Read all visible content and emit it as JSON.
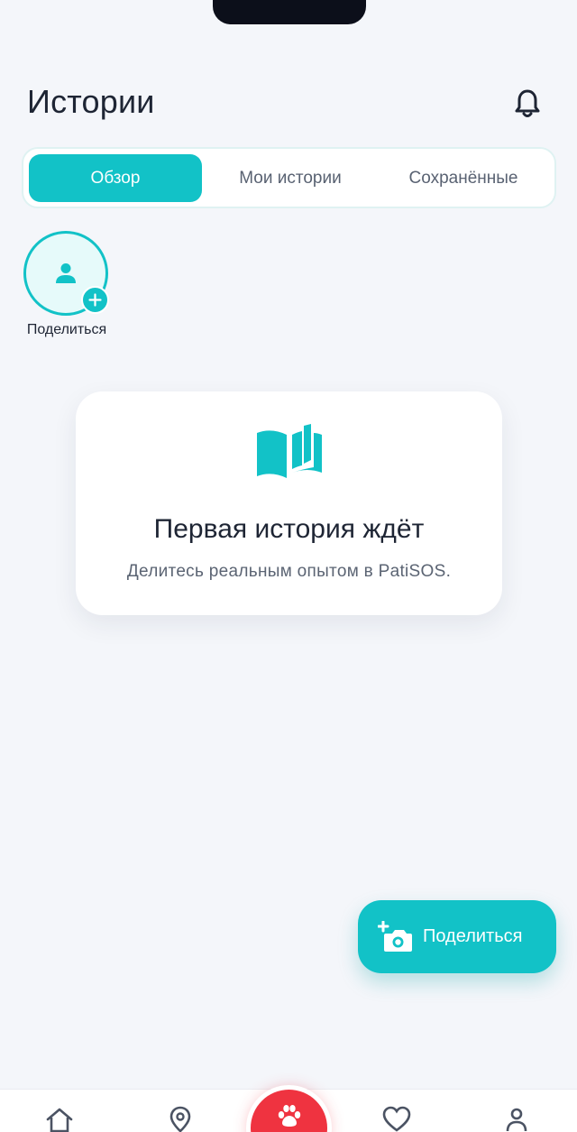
{
  "header": {
    "title": "Истории",
    "bell_icon": "bell-icon"
  },
  "tabs": [
    {
      "label": "Обзор",
      "active": true
    },
    {
      "label": "Мои истории",
      "active": false
    },
    {
      "label": "Сохранённые",
      "active": false
    }
  ],
  "stories": {
    "share_label": "Поделиться",
    "avatar_icon": "user-icon",
    "add_icon": "plus-icon"
  },
  "empty_state": {
    "icon": "open-book-icon",
    "title": "Первая история ждёт",
    "text": "Делитесь реальным опытом в PatiSOS."
  },
  "fab": {
    "label": "Поделиться",
    "icon": "add-photo-icon"
  },
  "bottom_nav": {
    "items": [
      "home-icon",
      "map-pin-icon",
      "paw-icon",
      "heart-icon",
      "profile-icon"
    ]
  },
  "colors": {
    "accent": "#12c2c7",
    "sos_red": "#ef3340",
    "background": "#f4f6fa",
    "text": "#1e2534"
  }
}
